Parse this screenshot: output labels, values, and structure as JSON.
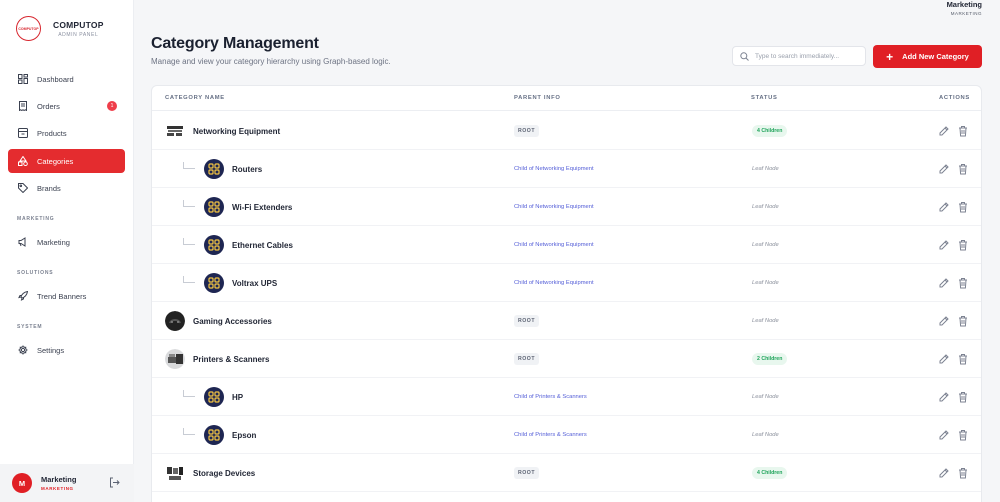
{
  "brand": {
    "name": "COMPUTOP",
    "subtitle": "ADMIN PANEL",
    "logo_text": "COMPUTOP"
  },
  "sidebar": {
    "items": [
      {
        "label": "Dashboard",
        "icon": "dashboard-icon"
      },
      {
        "label": "Orders",
        "icon": "receipt-icon",
        "badge": "1"
      },
      {
        "label": "Products",
        "icon": "box-icon"
      },
      {
        "label": "Categories",
        "icon": "shapes-icon",
        "active": true
      },
      {
        "label": "Brands",
        "icon": "tag-icon"
      }
    ],
    "sections": [
      {
        "title": "MARKETING",
        "items": [
          {
            "label": "Marketing",
            "icon": "megaphone-icon"
          }
        ]
      },
      {
        "title": "SOLUTIONS",
        "items": [
          {
            "label": "Trend Banners",
            "icon": "rocket-icon"
          }
        ]
      },
      {
        "title": "SYSTEM",
        "items": [
          {
            "label": "Settings",
            "icon": "gear-icon"
          }
        ]
      }
    ],
    "user": {
      "initial": "M",
      "name": "Marketing",
      "role": "MARKETING"
    }
  },
  "topbar": {
    "user_name": "Marketing",
    "user_role": "MARKETING"
  },
  "header": {
    "title": "Category Management",
    "subtitle": "Manage and view your category hierarchy using Graph-based logic.",
    "search_placeholder": "Type to search immediately...",
    "add_button": "Add New Category"
  },
  "table": {
    "columns": [
      "CATEGORY NAME",
      "PARENT INFO",
      "STATUS",
      "ACTIONS"
    ],
    "rows": [
      {
        "name": "Networking Equipment",
        "level": 0,
        "image": "photo",
        "parent": "ROOT",
        "status": "4 Children"
      },
      {
        "name": "Routers",
        "level": 1,
        "image": "icon",
        "parent": "Child of Networking Equipment",
        "status": "Leaf Node"
      },
      {
        "name": "Wi-Fi Extenders",
        "level": 1,
        "image": "icon",
        "parent": "Child of Networking Equipment",
        "status": "Leaf Node"
      },
      {
        "name": "Ethernet Cables",
        "level": 1,
        "image": "icon",
        "parent": "Child of Networking Equipment",
        "status": "Leaf Node"
      },
      {
        "name": "Voltrax UPS",
        "level": 1,
        "image": "icon",
        "parent": "Child of Networking Equipment",
        "status": "Leaf Node"
      },
      {
        "name": "Gaming Accessories",
        "level": 0,
        "image": "photo",
        "parent": "ROOT",
        "status": "Leaf Node"
      },
      {
        "name": "Printers & Scanners",
        "level": 0,
        "image": "photo",
        "parent": "ROOT",
        "status": "2 Children"
      },
      {
        "name": "HP",
        "level": 1,
        "image": "icon",
        "parent": "Child of Printers & Scanners",
        "status": "Leaf Node"
      },
      {
        "name": "Epson",
        "level": 1,
        "image": "icon",
        "parent": "Child of Printers & Scanners",
        "status": "Leaf Node"
      },
      {
        "name": "Storage Devices",
        "level": 0,
        "image": "photo",
        "parent": "ROOT",
        "status": "4 Children"
      }
    ]
  },
  "colors": {
    "accent": "#e01f25",
    "link": "#5660d8",
    "success": "#1ea35a",
    "icon_bg": "#1e2652"
  }
}
